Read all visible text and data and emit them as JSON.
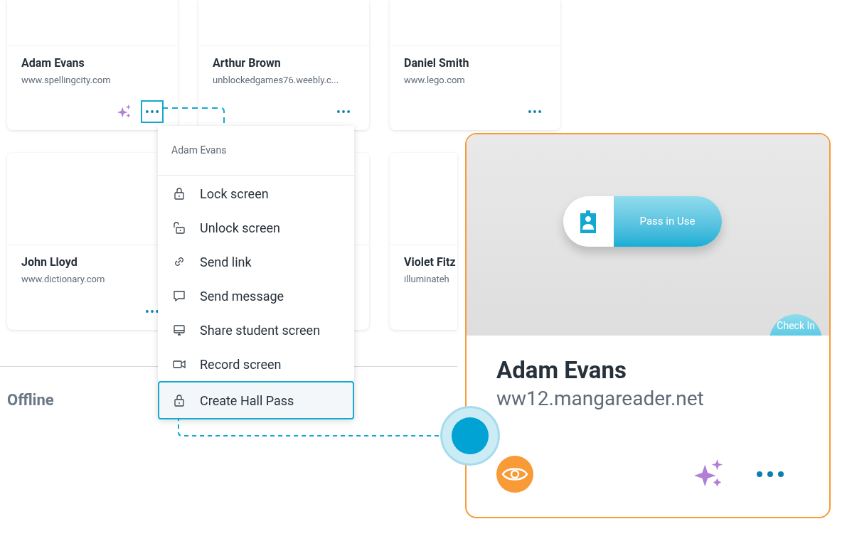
{
  "cards": [
    {
      "name": "Adam Evans",
      "url": "www.spellingcity.com",
      "sparkle": true,
      "menu_open": true
    },
    {
      "name": "Arthur Brown",
      "url": "unblockedgames76.weebly.c...",
      "sparkle": false,
      "menu_open": false
    },
    {
      "name": "Daniel Smith",
      "url": "www.lego.com",
      "sparkle": false,
      "menu_open": false
    },
    {
      "name": "John Lloyd",
      "url": "www.dictionary.com",
      "sparkle": false,
      "menu_open": false
    },
    {
      "kind": "blank"
    },
    {
      "kind": "partial",
      "name": "Violet Fitz",
      "url": "illuminateh"
    }
  ],
  "section": {
    "title": "Offline"
  },
  "menu": {
    "title": "Adam Evans",
    "items": [
      {
        "label": "Lock screen",
        "selected": false
      },
      {
        "label": "Unlock screen",
        "selected": false
      },
      {
        "label": "Send link",
        "selected": false
      },
      {
        "label": "Send message",
        "selected": false
      },
      {
        "label": "Share student screen",
        "selected": false
      },
      {
        "label": "Record screen",
        "selected": false
      },
      {
        "label": "Create Hall Pass",
        "selected": true
      }
    ]
  },
  "focus_card": {
    "name": "Adam Evans",
    "url": "ww12.mangareader.net",
    "pass_label": "Pass in Use",
    "check_in": "Check In",
    "sparkle": true
  }
}
